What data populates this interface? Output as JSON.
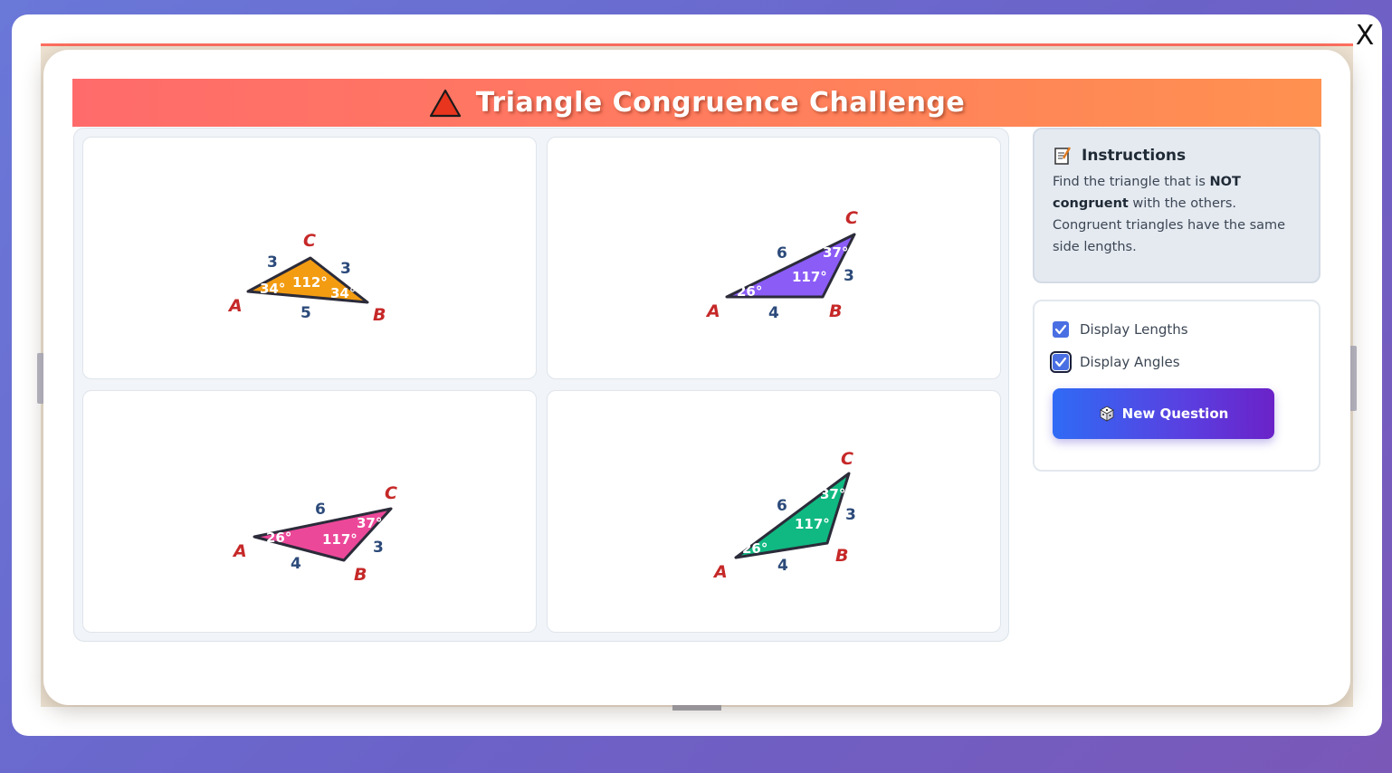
{
  "window": {
    "close_label": "X"
  },
  "header": {
    "title": "Triangle Congruence Challenge",
    "icon": "warning-triangle-icon"
  },
  "instructions": {
    "title": "Instructions",
    "icon": "memo-icon",
    "text_before": "Find the triangle that is ",
    "text_bold": "NOT congruent",
    "text_after": " with the others. Congruent triangles have the same side lengths."
  },
  "controls": {
    "display_lengths": {
      "label": "Display Lengths",
      "checked": true
    },
    "display_angles": {
      "label": "Display Angles",
      "checked": true
    },
    "new_question_label": "New Question",
    "new_question_icon": "dice-icon"
  },
  "triangles": [
    {
      "fill": "#f39c12",
      "vertices": {
        "A": "A",
        "B": "B",
        "C": "C"
      },
      "sides": {
        "AC": "3",
        "CB": "3",
        "AB": "5"
      },
      "angles": {
        "A": "34°",
        "C": "112°",
        "B": "34°"
      }
    },
    {
      "fill": "#8b5cf6",
      "vertices": {
        "A": "A",
        "B": "B",
        "C": "C"
      },
      "sides": {
        "AC": "6",
        "CB": "3",
        "AB": "4"
      },
      "angles": {
        "A": "26°",
        "B": "117°",
        "C": "37°"
      }
    },
    {
      "fill": "#ec4899",
      "vertices": {
        "A": "A",
        "B": "B",
        "C": "C"
      },
      "sides": {
        "AC": "6",
        "CB": "3",
        "AB": "4"
      },
      "angles": {
        "A": "26°",
        "B": "117°",
        "C": "37°"
      }
    },
    {
      "fill": "#10b981",
      "vertices": {
        "A": "A",
        "B": "B",
        "C": "C"
      },
      "sides": {
        "AC": "6",
        "CB": "3",
        "AB": "4"
      },
      "angles": {
        "A": "26°",
        "B": "117°",
        "C": "37°"
      }
    }
  ]
}
